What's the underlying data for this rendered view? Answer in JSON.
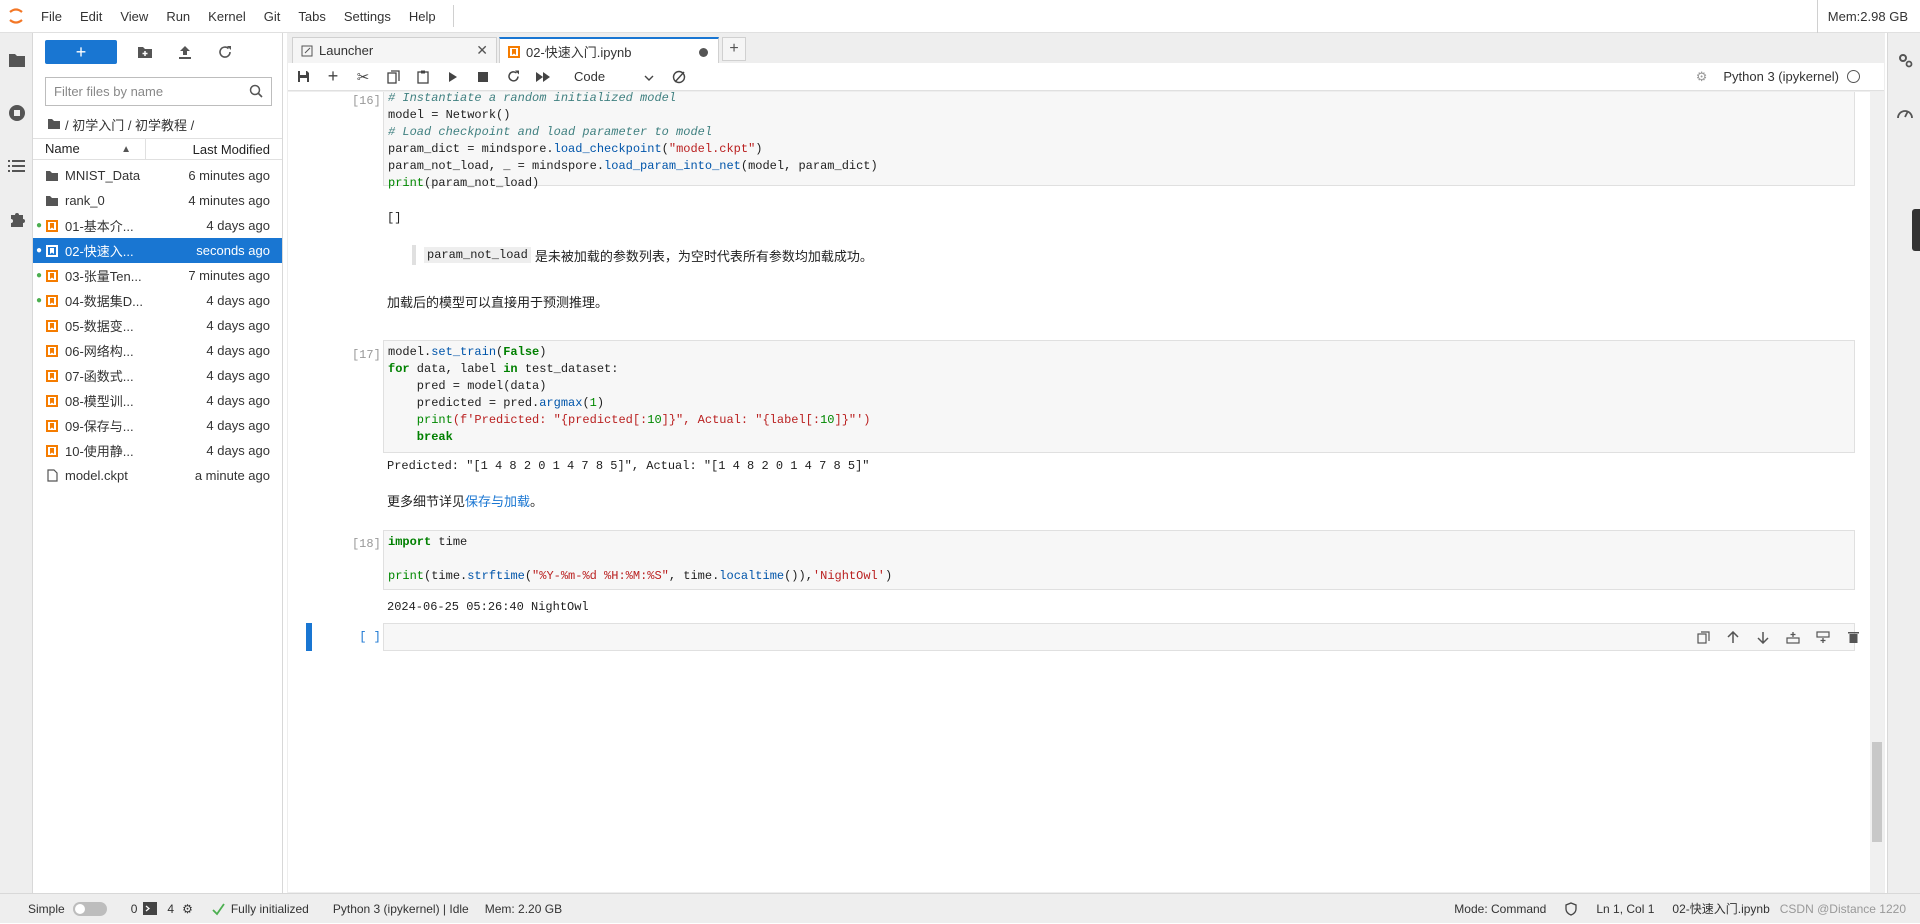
{
  "menubar": {
    "items": [
      "File",
      "Edit",
      "View",
      "Run",
      "Kernel",
      "Git",
      "Tabs",
      "Settings",
      "Help"
    ],
    "mem": "Mem:2.98 GB"
  },
  "leftbar": {
    "icons": [
      "folder-icon",
      "stop-circle-icon",
      "list-icon",
      "puzzle-icon"
    ]
  },
  "filebrowser": {
    "new_label": "+",
    "search_placeholder": "Filter files by name",
    "breadcrumb": "/ 初学入门 / 初学教程 /",
    "header_name": "Name",
    "header_modified": "Last Modified",
    "files": [
      {
        "name": "MNIST_Data",
        "modified": "6 minutes ago",
        "type": "folder",
        "running": false,
        "selected": false
      },
      {
        "name": "rank_0",
        "modified": "4 minutes ago",
        "type": "folder",
        "running": false,
        "selected": false
      },
      {
        "name": "01-基本介...",
        "modified": "4 days ago",
        "type": "notebook",
        "running": true,
        "selected": false
      },
      {
        "name": "02-快速入...",
        "modified": "seconds ago",
        "type": "notebook",
        "running": true,
        "selected": true
      },
      {
        "name": "03-张量Ten...",
        "modified": "7 minutes ago",
        "type": "notebook",
        "running": true,
        "selected": false
      },
      {
        "name": "04-数据集D...",
        "modified": "4 days ago",
        "type": "notebook",
        "running": true,
        "selected": false
      },
      {
        "name": "05-数据变...",
        "modified": "4 days ago",
        "type": "notebook",
        "running": false,
        "selected": false
      },
      {
        "name": "06-网络构...",
        "modified": "4 days ago",
        "type": "notebook",
        "running": false,
        "selected": false
      },
      {
        "name": "07-函数式...",
        "modified": "4 days ago",
        "type": "notebook",
        "running": false,
        "selected": false
      },
      {
        "name": "08-模型训...",
        "modified": "4 days ago",
        "type": "notebook",
        "running": false,
        "selected": false
      },
      {
        "name": "09-保存与...",
        "modified": "4 days ago",
        "type": "notebook",
        "running": false,
        "selected": false
      },
      {
        "name": "10-使用静...",
        "modified": "4 days ago",
        "type": "notebook",
        "running": false,
        "selected": false
      },
      {
        "name": "model.ckpt",
        "modified": "a minute ago",
        "type": "file",
        "running": false,
        "selected": false
      }
    ]
  },
  "tabs": [
    {
      "label": "Launcher"
    },
    {
      "label": "02-快速入门.ipynb"
    }
  ],
  "nbtoolbar": {
    "cell_type": "Code",
    "kernel": "Python 3 (ipykernel)"
  },
  "cells": {
    "c16_prompt": "[16]:",
    "c16_comment1": "# Instantiate a random initialized model",
    "c16_line2": "model = Network()",
    "c16_comment2": "# Load checkpoint and load parameter to model",
    "c16_line4a": "param_dict = mindspore.",
    "c16_line4b": "load_checkpoint",
    "c16_line4c": "(",
    "c16_line4d": "\"model.ckpt\"",
    "c16_line4e": ")",
    "c16_line5a": "param_not_load, _ = mindspore.",
    "c16_line5b": "load_param_into_net",
    "c16_line5c": "(model, param_dict)",
    "c16_line6a": "print",
    "c16_line6b": "(param_not_load)",
    "c16_output": "[]",
    "md_quote_code": "param_not_load",
    "md_quote_text": "是未被加载的参数列表，为空时代表所有参数均加载成功。",
    "md_para1": "加载后的模型可以直接用于预测推理。",
    "c17_prompt": "[17]:",
    "c17_l1a": "model.",
    "c17_l1b": "set_train",
    "c17_l1c": "(",
    "c17_l1d": "False",
    "c17_l1e": ")",
    "c17_l2a": "for",
    "c17_l2b": " data, label ",
    "c17_l2c": "in",
    "c17_l2d": " test_dataset:",
    "c17_l3": "    pred = model(data)",
    "c17_l4a": "    predicted = pred.",
    "c17_l4b": "argmax",
    "c17_l4c": "(",
    "c17_l4d": "1",
    "c17_l4e": ")",
    "c17_l5a": "    print",
    "c17_l5b": "(f'Predicted: \"{predicted[:",
    "c17_l5c": "10",
    "c17_l5d": "]}\", Actual: \"{label[:",
    "c17_l5e": "10",
    "c17_l5f": "]}\"')",
    "c17_l6": "    break",
    "c17_output": "Predicted: \"[1 4 8 2 0 1 4 7 8 5]\", Actual: \"[1 4 8 2 0 1 4 7 8 5]\"",
    "md_para2_text": "更多细节详见",
    "md_para2_link": "保存与加载",
    "md_para2_end": "。",
    "c18_prompt": "[18]:",
    "c18_l1a": "import",
    "c18_l1b": " time",
    "c18_l3a": "print",
    "c18_l3b": "(time.",
    "c18_l3c": "strftime",
    "c18_l3d": "(",
    "c18_l3e": "\"%Y-%m-%d %H:%M:%S\"",
    "c18_l3f": ", time.",
    "c18_l3g": "localtime",
    "c18_l3h": "()),",
    "c18_l3i": "'NightOwl'",
    "c18_l3j": ")",
    "c18_output": "2024-06-25 05:26:40 NightOwl",
    "c19_prompt": "[ ]:"
  },
  "statusbar": {
    "simple": "Simple",
    "count1": "0",
    "count2": "4",
    "git": "Fully initialized",
    "kernel_status": "Python 3 (ipykernel) | Idle",
    "mem": "Mem: 2.20 GB",
    "mode": "Mode: Command",
    "position": "Ln 1, Col 1",
    "filename": "02-快速入门.ipynb",
    "watermark": "CSDN @Distance 1220"
  },
  "colors": {
    "accent": "#1976d2",
    "running": "#4caf50",
    "notebook": "#f57c00"
  }
}
